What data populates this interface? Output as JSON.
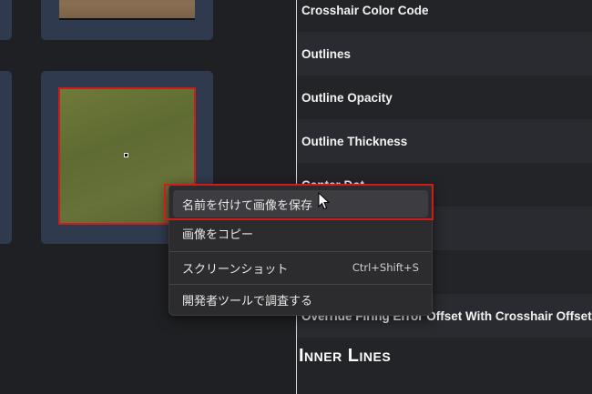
{
  "settings": {
    "rows": [
      "Crosshair Color Code",
      "Outlines",
      "Outline Opacity",
      "Outline Thickness",
      "Center Dot",
      "Override Firing Error Offset With Crosshair Offset"
    ],
    "section_heading": "Inner Lines"
  },
  "context_menu": {
    "items": [
      {
        "label": "名前を付けて画像を保存",
        "shortcut": ""
      },
      {
        "label": "画像をコピー",
        "shortcut": ""
      },
      {
        "label": "スクリーンショット",
        "shortcut": "Ctrl+Shift+S"
      },
      {
        "label": "開発者ツールで調査する",
        "shortcut": ""
      }
    ]
  },
  "colors": {
    "highlight": "#d11a1a",
    "tile_background": "#2f3a4e",
    "menu_background": "#2c2c2e"
  },
  "icons": {
    "cursor": "mouse-pointer-icon"
  }
}
